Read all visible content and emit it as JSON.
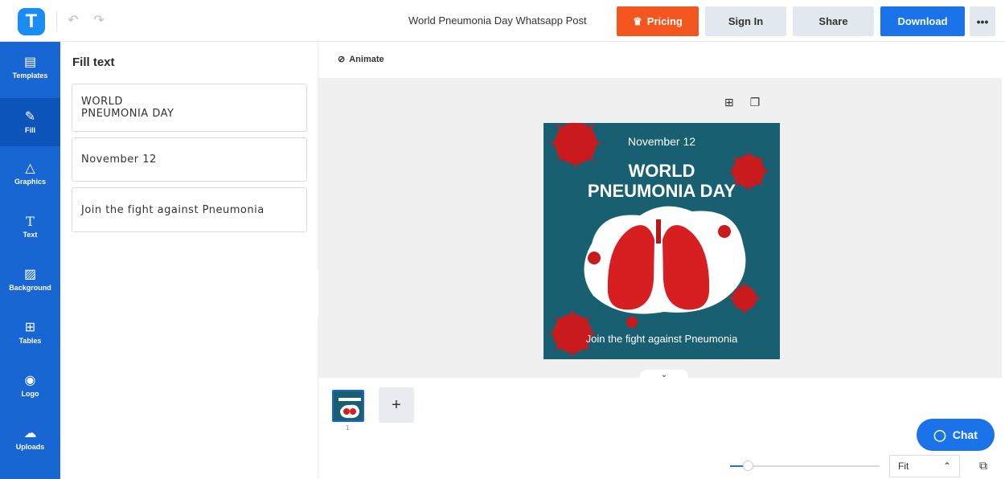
{
  "app": {
    "logo_letter": "T"
  },
  "header": {
    "doc_title": "World Pneumonia Day Whatsapp Post",
    "pricing_label": "Pricing",
    "signin_label": "Sign In",
    "share_label": "Share",
    "download_label": "Download",
    "more_label": "•••"
  },
  "rail": [
    {
      "label": "Templates",
      "icon": "templates-icon"
    },
    {
      "label": "Fill",
      "icon": "pencil-icon"
    },
    {
      "label": "Graphics",
      "icon": "shapes-icon"
    },
    {
      "label": "Text",
      "icon": "text-icon"
    },
    {
      "label": "Background",
      "icon": "background-icon"
    },
    {
      "label": "Tables",
      "icon": "table-icon"
    },
    {
      "label": "Logo",
      "icon": "logo-icon"
    },
    {
      "label": "Uploads",
      "icon": "cloud-upload-icon"
    }
  ],
  "panel": {
    "title": "Fill text",
    "fields": [
      "WORLD\nPNEUMONIA DAY",
      "November 12",
      "Join the fight against Pneumonia"
    ]
  },
  "canvas": {
    "animate_label": "Animate",
    "design": {
      "date": "November 12",
      "title": "WORLD\nPNEUMONIA DAY",
      "tagline": "Join the fight against Pneumonia",
      "bg_color": "#185f72",
      "accent_color": "#d71f22"
    }
  },
  "pages": {
    "current_page_number": "1",
    "add_label": "+"
  },
  "chat": {
    "label": "Chat"
  },
  "zoom": {
    "select_value": "Fit",
    "level_fraction": 0.12
  }
}
